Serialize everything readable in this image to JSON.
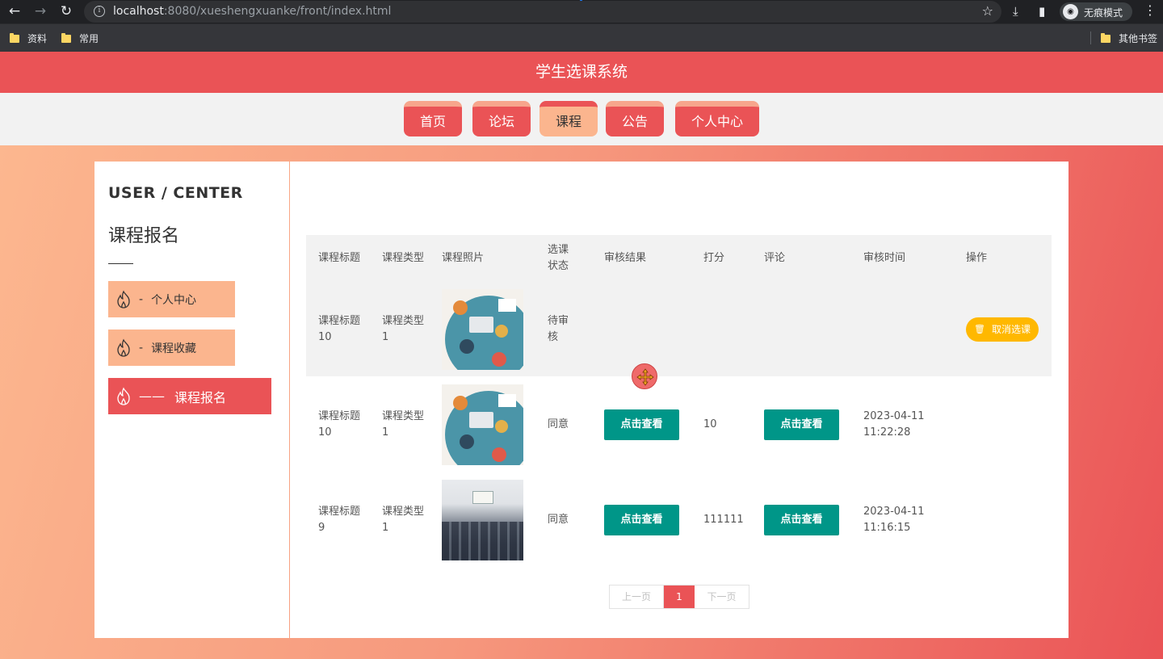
{
  "browser": {
    "url_host": "localhost",
    "url_rest": ":8080/xueshengxuanke/front/index.html",
    "incognito_label": "无痕模式",
    "bookmarks": [
      "资料",
      "常用"
    ],
    "other_bookmarks": "其他书签"
  },
  "site": {
    "title": "学生选课系统",
    "nav": [
      {
        "label": "首页",
        "active": false
      },
      {
        "label": "论坛",
        "active": false
      },
      {
        "label": "课程",
        "active": true
      },
      {
        "label": "公告",
        "active": false
      },
      {
        "label": "个人中心",
        "active": false
      }
    ]
  },
  "sidebar": {
    "title": "USER / CENTER",
    "subtitle": "课程报名",
    "items": [
      {
        "dash": "-",
        "label": "个人中心",
        "active": false
      },
      {
        "dash": "-",
        "label": "课程收藏",
        "active": false
      },
      {
        "dash": "——",
        "label": "课程报名",
        "active": true
      }
    ]
  },
  "table": {
    "headers": [
      "课程标题",
      "课程类型",
      "课程照片",
      "选课状态",
      "审核结果",
      "打分",
      "评论",
      "审核时间",
      "操作"
    ],
    "rows": [
      {
        "title": "课程标题10",
        "type": "课程类型1",
        "photo": "illustration",
        "status": "待审核",
        "result": "",
        "score": "",
        "comment": "",
        "time": "",
        "action": "取消选课"
      },
      {
        "title": "课程标题10",
        "type": "课程类型1",
        "photo": "illustration",
        "status": "同意",
        "result": "点击查看",
        "score": "10",
        "comment": "点击查看",
        "time": "2023-04-11 11:22:28",
        "action": ""
      },
      {
        "title": "课程标题9",
        "type": "课程类型1",
        "photo": "classroom-photo",
        "status": "同意",
        "result": "点击查看",
        "score": "111111",
        "comment": "点击查看",
        "time": "2023-04-11 11:16:15",
        "action": ""
      }
    ]
  },
  "pagination": {
    "prev": "上一页",
    "current": "1",
    "next": "下一页"
  },
  "colors": {
    "primary": "#ea5356",
    "accent": "#fbb58e",
    "teal": "#009688",
    "yellow": "#ffb800"
  }
}
